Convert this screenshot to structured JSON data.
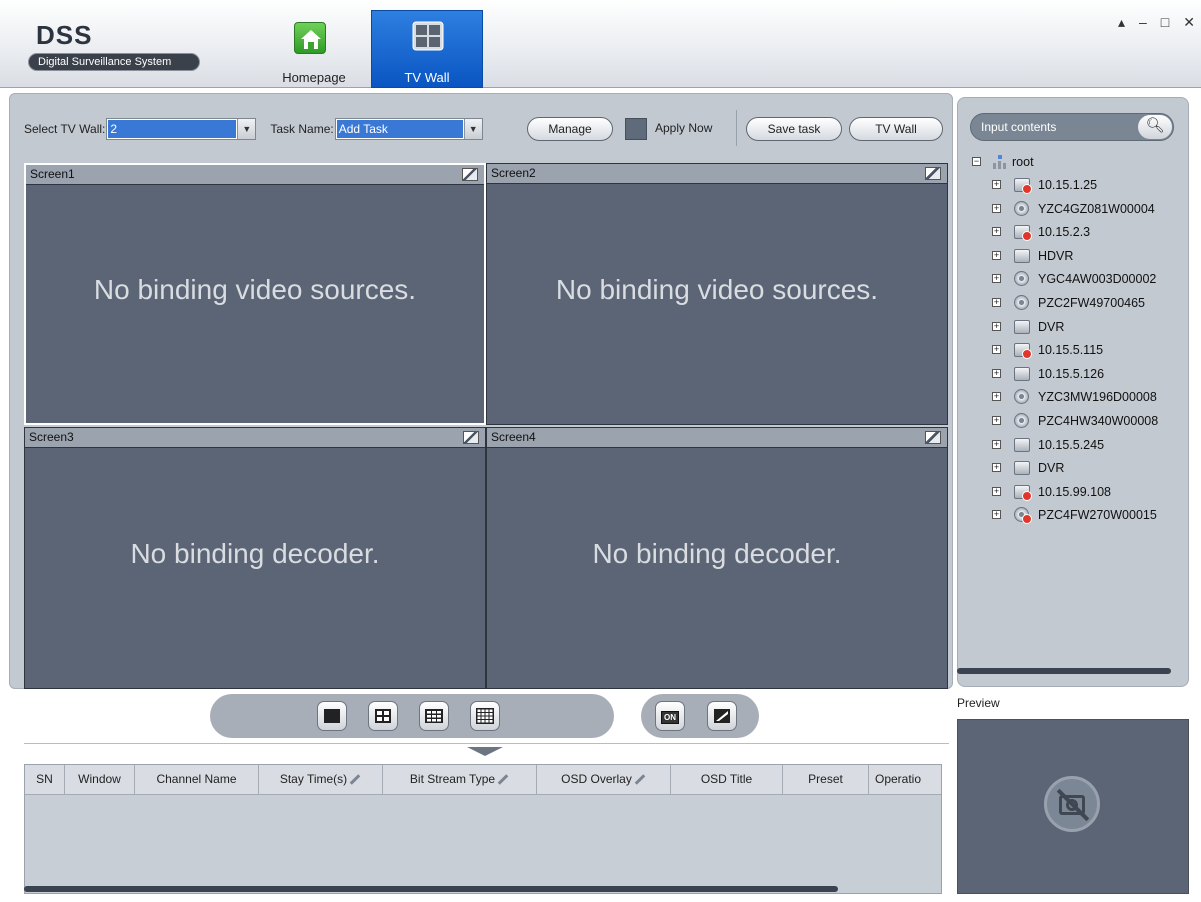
{
  "app": {
    "logo_title": "DSS",
    "logo_subtitle": "Digital Surveillance System"
  },
  "nav": {
    "home_label": "Homepage",
    "tvwall_label": "TV Wall",
    "active": "TV Wall"
  },
  "window_controls": [
    "lock",
    "minimize",
    "maximize",
    "close"
  ],
  "toolbar": {
    "select_tvwall_label": "Select TV Wall:",
    "select_tvwall_value": "2",
    "task_name_label": "Task Name:",
    "task_name_value": "Add Task",
    "manage_label": "Manage",
    "apply_now_label": "Apply Now",
    "save_task_label": "Save task",
    "tv_wall_label": "TV Wall"
  },
  "screens": [
    {
      "title": "Screen1",
      "message": "No binding video sources."
    },
    {
      "title": "Screen2",
      "message": "No binding video sources."
    },
    {
      "title": "Screen3",
      "message": "No binding decoder."
    },
    {
      "title": "Screen4",
      "message": "No binding decoder."
    }
  ],
  "split_controls": [
    "split-1-icon",
    "split-4-icon",
    "split-9-icon",
    "split-16-icon"
  ],
  "display_controls": {
    "on_label": "ON"
  },
  "table": {
    "columns": [
      "SN",
      "Window",
      "Channel Name",
      "Stay Time(s)",
      "Bit Stream Type",
      "OSD Overlay",
      "OSD Title",
      "Preset",
      "Operatio"
    ],
    "editable_columns": [
      "Stay Time(s)",
      "Bit Stream Type",
      "OSD Overlay"
    ],
    "rows": []
  },
  "right_panel": {
    "search_placeholder": "Input contents",
    "tree_root": "root",
    "devices": [
      {
        "name": "10.15.1.25",
        "type": "dvr",
        "offline": true
      },
      {
        "name": "YZC4GZ081W00004",
        "type": "camera",
        "offline": false
      },
      {
        "name": "10.15.2.3",
        "type": "dvr",
        "offline": true
      },
      {
        "name": "HDVR",
        "type": "dvr",
        "offline": false
      },
      {
        "name": "YGC4AW003D00002",
        "type": "camera",
        "offline": false
      },
      {
        "name": "PZC2FW49700465",
        "type": "camera",
        "offline": false
      },
      {
        "name": "DVR",
        "type": "dvr",
        "offline": false
      },
      {
        "name": "10.15.5.115",
        "type": "dvr",
        "offline": true
      },
      {
        "name": "10.15.5.126",
        "type": "dvr",
        "offline": false
      },
      {
        "name": "YZC3MW196D00008",
        "type": "camera",
        "offline": false
      },
      {
        "name": "PZC4HW340W00008",
        "type": "camera",
        "offline": false
      },
      {
        "name": "10.15.5.245",
        "type": "dvr",
        "offline": false
      },
      {
        "name": "DVR",
        "type": "dvr",
        "offline": false
      },
      {
        "name": "10.15.99.108",
        "type": "dvr",
        "offline": true
      },
      {
        "name": "PZC4FW270W00015",
        "type": "camera",
        "offline": true
      }
    ],
    "preview_label": "Preview"
  },
  "colors": {
    "accent": "#0a55c2",
    "screen_bg": "#5c6575",
    "offline_badge": "#e0362c"
  }
}
